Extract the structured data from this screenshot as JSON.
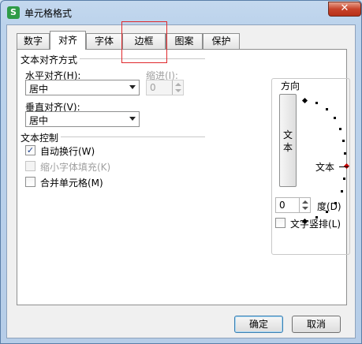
{
  "window": {
    "title": "单元格格式",
    "app_icon_glyph": "S",
    "close_glyph": "✕"
  },
  "tabs": [
    {
      "label": "数字"
    },
    {
      "label": "对齐"
    },
    {
      "label": "字体"
    },
    {
      "label": "边框"
    },
    {
      "label": "图案"
    },
    {
      "label": "保护"
    }
  ],
  "active_tab": "对齐",
  "text_alignment": {
    "group_title": "文本对齐方式",
    "horizontal_label": "水平对齐(H):",
    "horizontal_value": "居中",
    "indent_label": "缩进(I):",
    "indent_value": "0",
    "vertical_label": "垂直对齐(V):",
    "vertical_value": "居中"
  },
  "text_control": {
    "group_title": "文本控制",
    "wrap_text": {
      "label": "自动换行(W)",
      "checked": true,
      "enabled": true
    },
    "shrink_to_fit": {
      "label": "缩小字体填充(K)",
      "checked": false,
      "enabled": false
    },
    "merge_cells": {
      "label": "合并单元格(M)",
      "checked": false,
      "enabled": true
    }
  },
  "orientation": {
    "group_title": "方向",
    "vertical_text_chars": [
      "文",
      "本"
    ],
    "dial_label": "文本",
    "degrees_value": "0",
    "degrees_label": "度(D)",
    "vertical_text_checkbox": {
      "label": "文字竖排(L)",
      "checked": false
    }
  },
  "buttons": {
    "ok": "确定",
    "cancel": "取消"
  },
  "colors": {
    "highlight_box": "#e0282c",
    "title_gradient": "#bcd3ec",
    "close_button": "#c7432a"
  }
}
